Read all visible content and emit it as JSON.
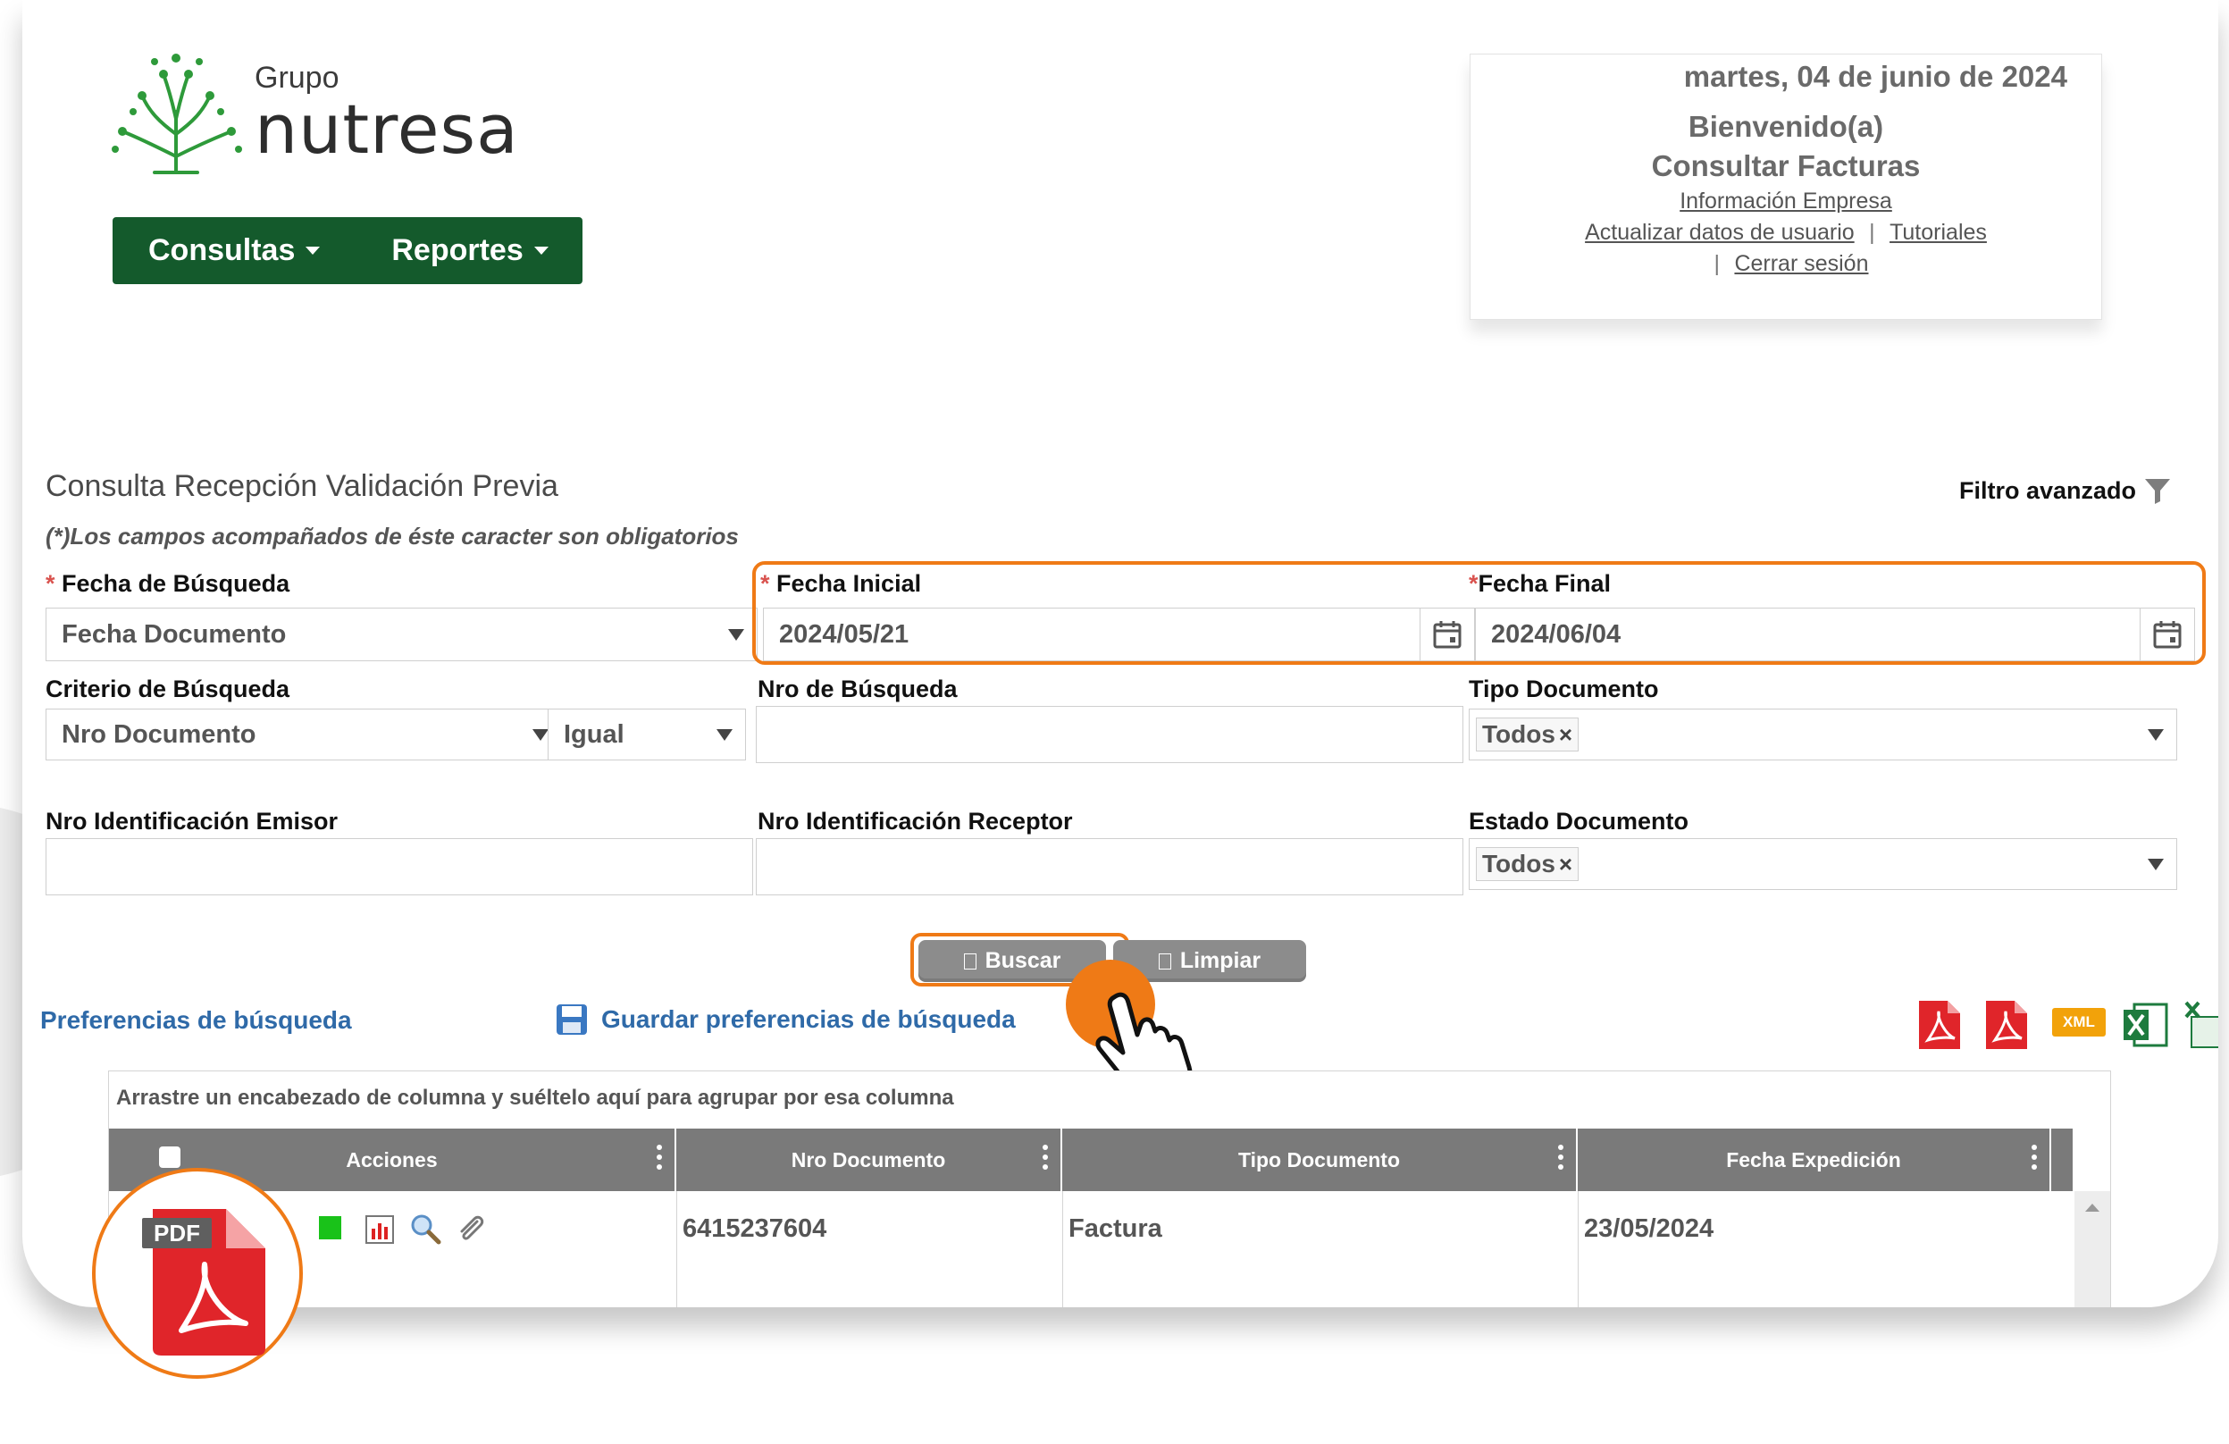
{
  "brand": {
    "grupo": "Grupo",
    "name": "nutresa",
    "color": "#2e9a3a"
  },
  "menu": {
    "items": [
      {
        "label": "Consultas"
      },
      {
        "label": "Reportes"
      }
    ]
  },
  "user_panel": {
    "date": "martes, 04 de junio de 2024",
    "welcome": "Bienvenido(a)",
    "section": "Consultar Facturas",
    "links": {
      "info_empresa": "Información Empresa",
      "actualizar": "Actualizar datos de usuario",
      "tutoriales": "Tutoriales",
      "cerrar": "Cerrar sesión",
      "pipe": "|"
    }
  },
  "form": {
    "title": "Consulta Recepción Validación Previa",
    "required_note": "(*)Los campos acompañados de éste caracter son obligatorios",
    "advanced_filter": "Filtro avanzado",
    "asterisk": "*",
    "fecha_busqueda": {
      "label": "Fecha de Búsqueda",
      "value": "Fecha Documento"
    },
    "fecha_inicial": {
      "label": "Fecha Inicial",
      "value": "2024/05/21"
    },
    "fecha_final": {
      "label": "Fecha Final",
      "value": "2024/06/04"
    },
    "criterio": {
      "label": "Criterio de Búsqueda",
      "value": "Nro Documento",
      "operator": "Igual"
    },
    "nro_busqueda": {
      "label": "Nro de Búsqueda",
      "value": ""
    },
    "tipo_documento": {
      "label": "Tipo Documento",
      "tag": "Todos",
      "tag_remove": "×"
    },
    "emisor": {
      "label": "Nro Identificación Emisor",
      "value": ""
    },
    "receptor": {
      "label": "Nro Identificación Receptor",
      "value": ""
    },
    "estado_documento": {
      "label": "Estado Documento",
      "tag": "Todos",
      "tag_remove": "×"
    },
    "buttons": {
      "buscar": "Buscar",
      "limpiar": "Limpiar"
    }
  },
  "toolbar": {
    "preferencias": "Preferencias de búsqueda",
    "guardar": "Guardar preferencias de búsqueda",
    "exports": [
      "pdf-icon",
      "pdf-icon",
      "xml-icon",
      "excel-icon",
      "csv-icon"
    ],
    "xml_label": "XML"
  },
  "grid": {
    "group_hint": "Arrastre un encabezado de columna y suéltelo aquí para agrupar por esa columna",
    "columns": [
      "Acciones",
      "Nro Documento",
      "Tipo Documento",
      "Fecha Expedición"
    ],
    "rows": [
      {
        "nro_documento": "6415237604",
        "tipo_documento": "Factura",
        "fecha_expedicion": "23/05/2024",
        "overflow": "8"
      }
    ]
  },
  "callout": {
    "label": "PDF"
  },
  "colors": {
    "highlight": "#ef7a16",
    "menu_bg": "#145a2c",
    "link": "#2f6aa8",
    "grid_header": "#7a7a7a"
  }
}
